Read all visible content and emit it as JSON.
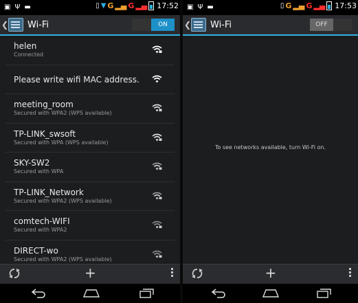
{
  "left": {
    "status": {
      "network": "G",
      "time": "17:52"
    },
    "action_bar": {
      "title": "Wi-Fi",
      "toggle_label": "ON"
    },
    "networks": [
      {
        "ssid": "helen",
        "detail": "Connected"
      },
      {
        "ssid": "Please write wifi MAC address.",
        "detail": ""
      },
      {
        "ssid": "meeting_room",
        "detail": "Secured with WPA2 (WPS available)"
      },
      {
        "ssid": "TP-LINK_swsoft",
        "detail": "Secured with WPA (WPS available)"
      },
      {
        "ssid": "SKY-SW2",
        "detail": "Secured with WPA"
      },
      {
        "ssid": "TP-LINK_Network",
        "detail": "Secured with WPA2 (WPS available)"
      },
      {
        "ssid": "comtech-WIFI",
        "detail": "Secured with WPA2"
      },
      {
        "ssid": "DIRECT-wo",
        "detail": "Secured with WPA2 (WPS available)"
      }
    ]
  },
  "right": {
    "status": {
      "network": "G",
      "time": "17:53"
    },
    "action_bar": {
      "title": "Wi-Fi",
      "toggle_label": "OFF"
    },
    "empty_message": "To see networks available, turn Wi-Fi on."
  },
  "bottom_bar": {
    "add_label": "+"
  },
  "icons": {
    "wifi": "wifi-signal-icon",
    "wps": "wps-icon",
    "add": "add-icon",
    "menu": "overflow-menu-icon",
    "back": "back-icon",
    "home": "home-icon",
    "recents": "recents-icon"
  },
  "colors": {
    "accent": "#33b5e5",
    "toggle_on": "#1e90c8",
    "background": "#1c1d1f"
  }
}
